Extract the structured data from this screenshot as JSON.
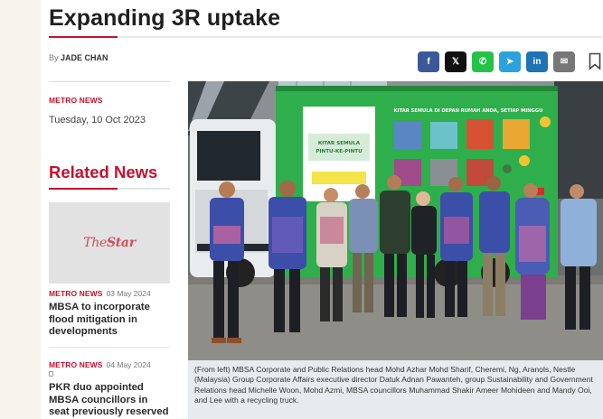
{
  "article": {
    "title": "Expanding 3R uptake",
    "byline_prefix": "By",
    "author": "JADE CHAN",
    "section": "METRO NEWS",
    "date": "Tuesday, 10 Oct 2023"
  },
  "share": {
    "buttons": [
      {
        "name": "facebook-share-button",
        "glyph": "f",
        "icon": "facebook-icon"
      },
      {
        "name": "x-share-button",
        "glyph": "𝕏",
        "icon": "x-icon"
      },
      {
        "name": "whatsapp-share-button",
        "glyph": "✆",
        "icon": "whatsapp-icon"
      },
      {
        "name": "telegram-share-button",
        "glyph": "➤",
        "icon": "telegram-icon"
      },
      {
        "name": "linkedin-share-button",
        "glyph": "in",
        "icon": "linkedin-icon"
      },
      {
        "name": "email-share-button",
        "glyph": "✉",
        "icon": "email-icon"
      }
    ],
    "bookmark_icon": "bookmark-icon"
  },
  "related": {
    "heading": "Related News",
    "thumb_logo": "TheStar",
    "items": [
      {
        "section": "METRO NEWS",
        "date": "03 May 2024",
        "headline": "MBSA to incorporate flood mitigation in developments"
      },
      {
        "section": "METRO NEWS",
        "date": "04 May 2024",
        "headline": "PKR duo appointed MBSA councillors in seat previously reserved for"
      }
    ]
  },
  "photo": {
    "banner_left": "KITAR SEMULA PINTU-KE-PINTU",
    "banner_right": "KITAR SEMULA DI DEPAN RUMAH ANDA, SETIAP MINGGU",
    "caption": "(From left) MBSA Corporate and Public Relations head Mohd Azhar Mohd Sharif, Cheremi, Ng, Aranols, Nestle (Malaysia) Group Corporate Affairs executive director Datuk Adnan Pawanteh, group Sustainability and Government Relations head Michelle Woon, Mohd Azmi, MBSA councillors Muhammad Shakir Ameer Mohideen and Mandy Ooi, and Lee with a recycling truck."
  },
  "colors": {
    "accent": "#c8102e",
    "truck_green": "#2fae4c",
    "batik_blue": "#3c4fa8"
  }
}
